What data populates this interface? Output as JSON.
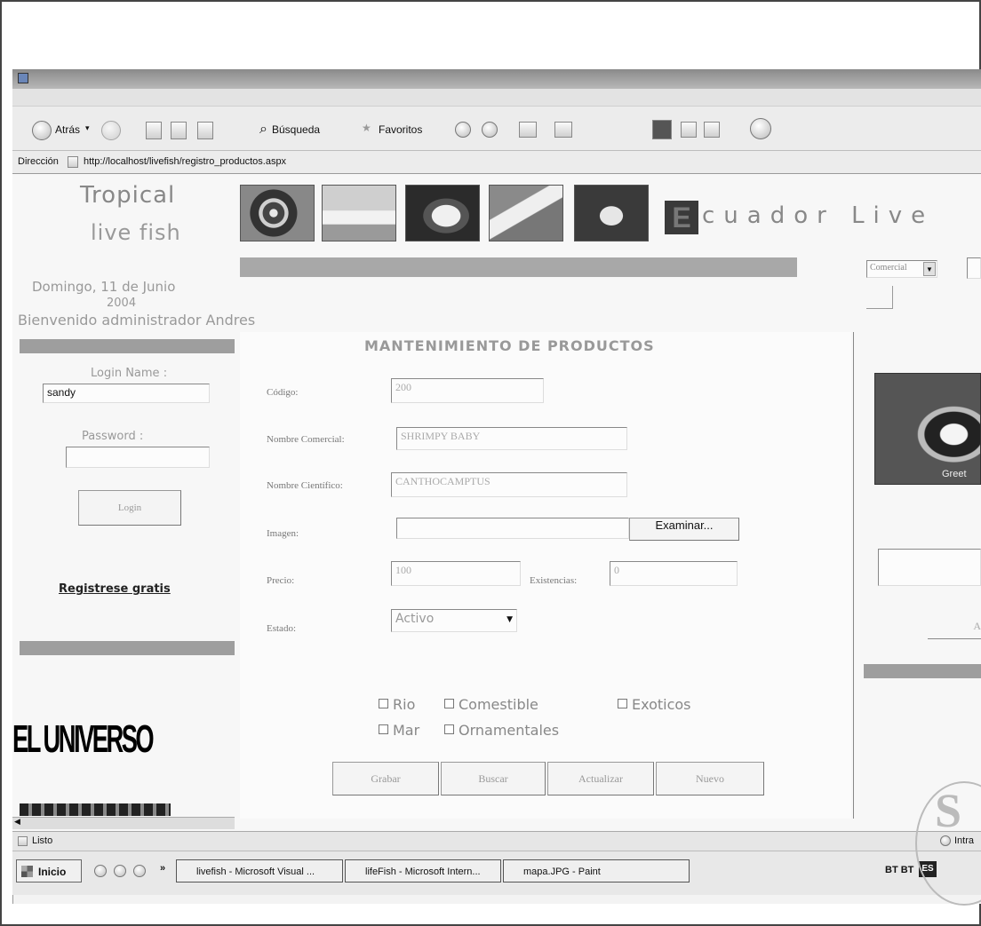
{
  "browser": {
    "menu": [
      "",
      "",
      "",
      "",
      "",
      ""
    ],
    "toolbar": {
      "back": "Atrás",
      "search": "Búsqueda",
      "favorites": "Favoritos"
    },
    "address_label": "Dirección",
    "address_url": "http://localhost/livefish/registro_productos.aspx",
    "status": "Listo",
    "zone": "Intra"
  },
  "site": {
    "logo_line1": "Tropical",
    "logo_line2": "live fish",
    "brand_letter": "E",
    "brand_rest": "cuador Live",
    "date_line1": "Domingo, 11 de Junio",
    "date_line2": "2004",
    "welcome": "Bienvenido administrador Andres",
    "nav": [
      "",
      "",
      "",
      "",
      "",
      ""
    ],
    "category_select": "Comercial"
  },
  "left": {
    "member_header": "",
    "login_label": "Login Name :",
    "login_value": "sandy",
    "password_label": "Password :",
    "login_button": "Login",
    "register_link": "Registrese gratis",
    "links_header": "",
    "sponsor_logo": "EL UNIVERSO"
  },
  "form": {
    "title": "MANTENIMIENTO DE PRODUCTOS",
    "codigo_label": "Código:",
    "codigo_value": "200",
    "nombre_comercial_label": "Nombre Comercial:",
    "nombre_comercial_value": "SHRIMPY BABY",
    "nombre_cientifico_label": "Nombre Científico:",
    "nombre_cientifico_value": "CANTHOCAMPTUS",
    "imagen_label": "Imagen:",
    "examinar_button": "Examinar...",
    "precio_label": "Precio:",
    "precio_value": "100",
    "existencias_label": "Existencias:",
    "existencias_value": "0",
    "estado_label": "Estado:",
    "estado_value": "Activo",
    "checks": [
      "Rio",
      "Comestible",
      "Exoticos",
      "Mar",
      "Ornamentales"
    ],
    "buttons": [
      "Grabar",
      "Buscar",
      "Actualizar",
      "Nuevo"
    ]
  },
  "right": {
    "image_caption": "Greet",
    "header": "",
    "button_partial": "A"
  },
  "taskbar": {
    "start": "Inicio",
    "tasks": [
      "livefish - Microsoft Visual ...",
      "lifeFish - Microsoft Intern...",
      "mapa.JPG - Paint"
    ],
    "tray_text": "BT BT",
    "lang": "ES"
  },
  "stamp_text": "S"
}
